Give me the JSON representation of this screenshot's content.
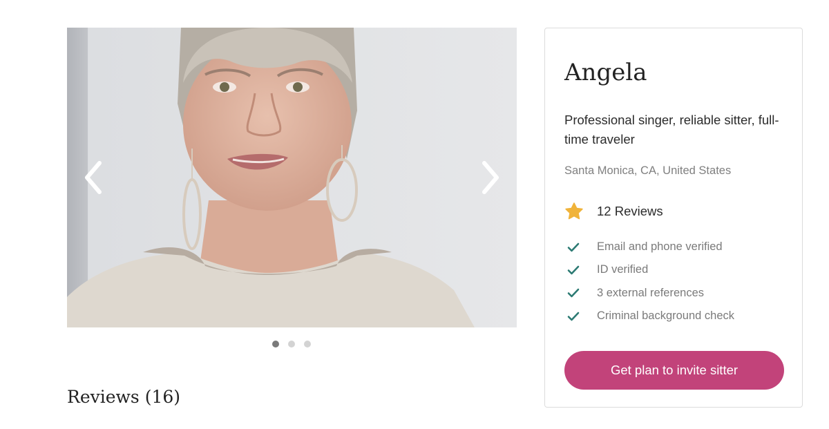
{
  "carousel": {
    "prev_icon": "chevron-left-icon",
    "next_icon": "chevron-right-icon",
    "slide_count": 3,
    "active_slide": 1
  },
  "reviews_section": {
    "heading": "Reviews (16)"
  },
  "profile": {
    "name": "Angela",
    "tagline": "Professional singer, reliable sitter, full-time traveler",
    "location": "Santa Monica, CA, United States",
    "rating": {
      "icon": "star-icon",
      "label": "12 Reviews"
    },
    "verifications": [
      {
        "icon": "check-icon",
        "label": "Email and phone verified"
      },
      {
        "icon": "check-icon",
        "label": "ID verified"
      },
      {
        "icon": "check-icon",
        "label": "3 external references"
      },
      {
        "icon": "check-icon",
        "label": "Criminal background check"
      }
    ],
    "cta_label": "Get plan to invite sitter"
  },
  "colors": {
    "accent": "#c2437a",
    "star": "#f0b33a",
    "check": "#2c7a73",
    "muted_text": "#7a7a7a"
  }
}
